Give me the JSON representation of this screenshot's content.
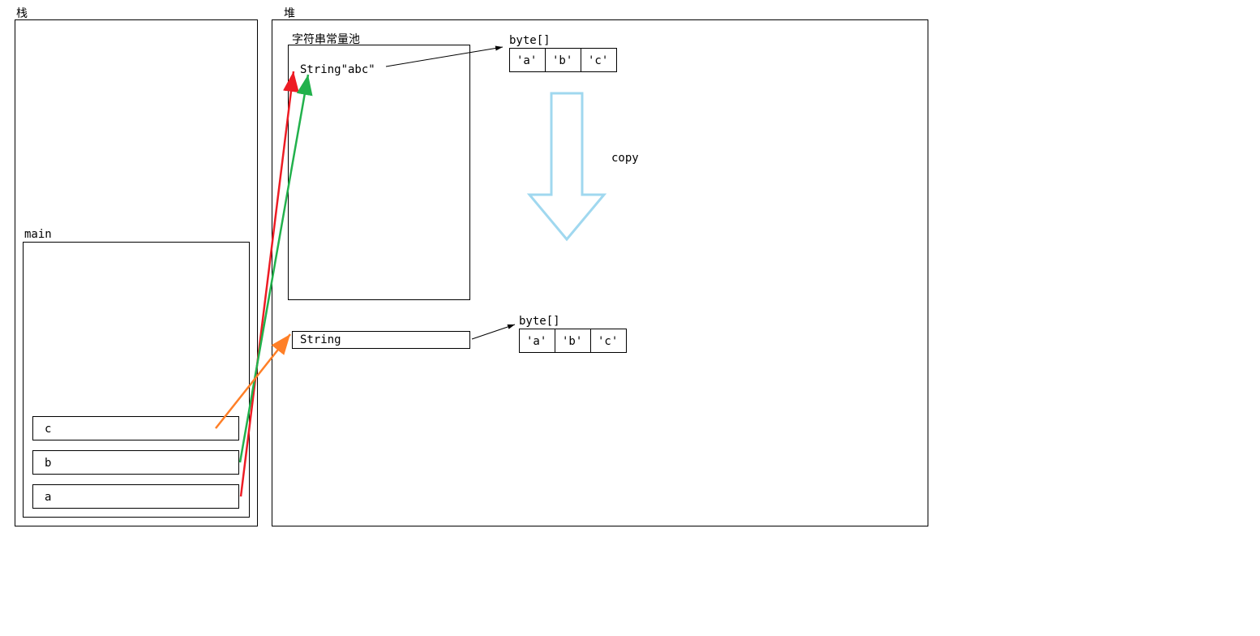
{
  "stack": {
    "title": "栈",
    "main_label": "main",
    "vars": [
      "c",
      "b",
      "a"
    ]
  },
  "heap": {
    "title": "堆",
    "string_pool_label": "字符串常量池",
    "pool_string": "String\"abc\"",
    "new_string": "String",
    "byte_label_1": "byte[]",
    "byte_label_2": "byte[]",
    "bytes": [
      "'a'",
      "'b'",
      "'c'"
    ],
    "copy_label": "copy"
  }
}
